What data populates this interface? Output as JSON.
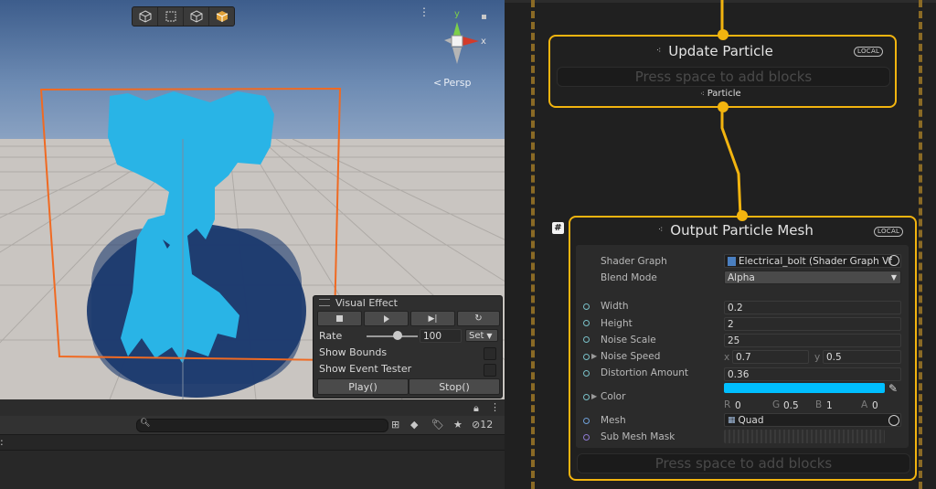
{
  "scene": {
    "toolbar_icons": [
      "cube-icon",
      "rect-select-icon",
      "cube-outline-icon",
      "cube-color-icon"
    ],
    "gizmo": {
      "x_label": "x",
      "y_label": "y",
      "projection_label": "Persp"
    },
    "visual_effect_panel": {
      "title": "Visual Effect",
      "transport_icons": [
        "stop-icon",
        "play-icon",
        "step-icon",
        "restart-icon"
      ],
      "rate_label": "Rate",
      "rate_value": "100",
      "rate_fraction": 0.6,
      "set_label": "Set",
      "show_bounds_label": "Show Bounds",
      "show_event_tester_label": "Show Event Tester",
      "play_button": "Play()",
      "stop_button": "Stop()"
    }
  },
  "bottom_bar": {
    "visibility_count": "12"
  },
  "graph": {
    "update_node": {
      "title": "Update Particle",
      "badge": "LOCAL",
      "add_blocks": "Press space to add blocks",
      "output_label": "Particle"
    },
    "output_node": {
      "title": "Output Particle Mesh",
      "badge": "LOCAL",
      "hash_badge": "#",
      "add_blocks": "Press space to add blocks",
      "shader_graph_label": "Shader Graph",
      "shader_graph_value": "Electrical_bolt (Shader Graph Vfx .",
      "blend_mode_label": "Blend Mode",
      "blend_mode_value": "Alpha",
      "width_label": "Width",
      "width_value": "0.2",
      "height_label": "Height",
      "height_value": "2",
      "noise_scale_label": "Noise Scale",
      "noise_scale_value": "25",
      "noise_speed_label": "Noise Speed",
      "noise_speed_x_label": "x",
      "noise_speed_x": "0.7",
      "noise_speed_y_label": "y",
      "noise_speed_y": "0.5",
      "distortion_label": "Distortion Amount",
      "distortion_value": "0.36",
      "color_label": "Color",
      "color_hex": "#00bfff",
      "color_r_label": "R",
      "color_r": "0",
      "color_g_label": "G",
      "color_g": "0.5",
      "color_b_label": "B",
      "color_b": "1",
      "color_a_label": "A",
      "color_a": "0",
      "mesh_label": "Mesh",
      "mesh_value": "Quad",
      "submesh_label": "Sub Mesh Mask"
    }
  },
  "colors": {
    "accent_node": "#f2b40f",
    "bounds_orange": "#f06a22",
    "particle_blue": "#29b4e6"
  }
}
